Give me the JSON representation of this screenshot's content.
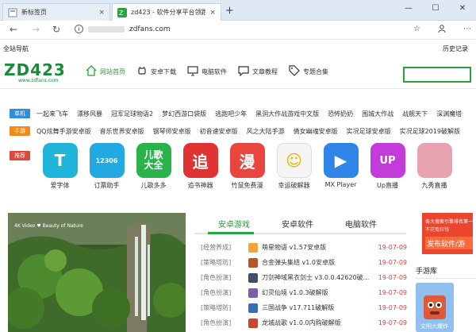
{
  "browser": {
    "tabs": [
      {
        "title": "新标签页",
        "close": "×"
      },
      {
        "title": "zd423 - 软件分享平台领跑者",
        "close": "×"
      }
    ],
    "new_tab": "+",
    "window_controls": [
      "—",
      "☐",
      "✕"
    ],
    "nav": {
      "back": "←",
      "forward": "→",
      "reload": "↻"
    },
    "url": "zdfans.com",
    "tools": {
      "star": "☆",
      "user": "person-icon",
      "more": "⋯"
    }
  },
  "site": {
    "top_left": "全站导航",
    "top_right": "历史记录",
    "logo_text": "ZD423",
    "logo_domain": "www.zdfans.com",
    "brand_color": "#2aa33f",
    "nav": [
      {
        "label": "网站首页",
        "icon": "home-icon",
        "active": true
      },
      {
        "label": "安卓下载",
        "icon": "android-icon",
        "active": false
      },
      {
        "label": "电脑软件",
        "icon": "monitor-icon",
        "active": false
      },
      {
        "label": "文章教程",
        "icon": "chat-icon",
        "active": false
      },
      {
        "label": "专题合集",
        "icon": "tag-icon",
        "active": false
      }
    ],
    "tag_rows": [
      {
        "badge": "单机",
        "color": "#2f8ee0",
        "items": [
          "一起来飞车",
          "漂移风暴",
          "冠军足球物语2",
          "梦幻西游口袋版",
          "逃跑吧少年",
          "黑洞大作战游戏中文版",
          "恐怖奶奶",
          "围城大作战",
          "战舰天下",
          "深渊魔塔"
        ]
      },
      {
        "badge": "手游",
        "color": "#f08a1c",
        "items": [
          "QQ炫舞手游安卓版",
          "音乐世界安卓版",
          "钢琴师安卓版",
          "初音速安卓版",
          "风之大陆手游",
          "倩女幽魂安卓版",
          "实况足球安卓版",
          "实况足球2019破解版"
        ]
      },
      {
        "badge": "推荐",
        "color": "#e0473c",
        "items": []
      }
    ],
    "apps": [
      {
        "name": "爱字体",
        "bg": "#1fb5d8",
        "glyph": "T"
      },
      {
        "name": "订票助手",
        "bg": "#23a9e1",
        "glyph": "12306"
      },
      {
        "name": "儿歌多多",
        "bg": "#29b34a",
        "glyph": "儿歌大全"
      },
      {
        "name": "追书神器",
        "bg": "#e03434",
        "glyph": "追"
      },
      {
        "name": "竹鼠免费漫",
        "bg": "#e8463f",
        "glyph": "漫"
      },
      {
        "name": "幸运破解器",
        "bg": "#f5f5f5",
        "glyph": "☺"
      },
      {
        "name": "MX Player",
        "bg": "#2f86e6",
        "glyph": "▶"
      },
      {
        "name": "Up直播",
        "bg": "#c33bd9",
        "glyph": "UP"
      },
      {
        "name": "九秀直播",
        "bg": "#e8a3b2",
        "glyph": ""
      }
    ],
    "banner_caption": "4K Video ♥ Beauty of Nature",
    "content_tabs": [
      {
        "label": "安卓游戏",
        "active": true
      },
      {
        "label": "安卓软件",
        "active": false
      },
      {
        "label": "电脑软件",
        "active": false
      }
    ],
    "list": [
      {
        "cat": "[经营养成]",
        "name": "萌星物语 v1.57安卓版",
        "date": "19-07-09",
        "color": "#f3a535"
      },
      {
        "cat": "[策略塔防]",
        "name": "合金弹头集结 v1.0安卓版",
        "date": "19-07-09",
        "color": "#b5552a"
      },
      {
        "cat": "[角色扮演]",
        "name": "刀剑神域黑衣剑士 v3.0.0.42620破...",
        "date": "19-07-09",
        "color": "#4a4a68"
      },
      {
        "cat": "[角色扮演]",
        "name": "幻灵仙境 v1.0.3破解版",
        "date": "19-07-09",
        "color": "#7b5fa8"
      },
      {
        "cat": "[策略塔防]",
        "name": "三国战争 v17.711破解版",
        "date": "19-07-09",
        "color": "#3a6fb5"
      },
      {
        "cat": "[角色扮演]",
        "name": "龙城战歌 v1.0.0内购破解版",
        "date": "19-07-09",
        "color": "#c8462d"
      }
    ],
    "ad": {
      "line1": "各大搜索引擎排名第一",
      "line2": "不花冤枉钱",
      "button": "发布软件/游"
    },
    "sidebar_title": "手游库",
    "sidebar_game": "文明大爆炸"
  }
}
